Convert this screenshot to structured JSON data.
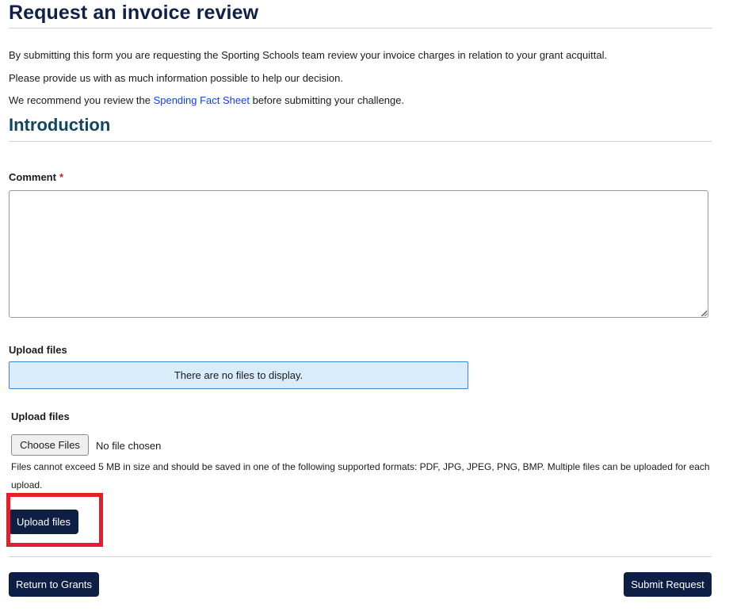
{
  "header": {
    "title": "Request an invoice review"
  },
  "intro": {
    "line1": "By submitting this form you are requesting the Sporting Schools team review your invoice charges in relation to your grant acquittal.",
    "line2": "Please provide us with as much information possible to help our decision.",
    "line3_prefix": "We recommend you review the ",
    "line3_link": "Spending Fact Sheet",
    "line3_suffix": " before submitting your challenge."
  },
  "section": {
    "title": "Introduction"
  },
  "comment": {
    "label": "Comment",
    "required_mark": "*",
    "value": ""
  },
  "attached_files": {
    "label": "Upload files",
    "empty_message": "There are no files to display."
  },
  "uploader": {
    "label": "Upload files",
    "choose_button": "Choose Files",
    "chosen_status": "No file chosen",
    "help_text": "Files cannot exceed 5 MB in size and should be saved in one of the following supported formats: PDF, JPG, JPEG, PNG, BMP. Multiple files can be uploaded for each upload.",
    "upload_button": "Upload files"
  },
  "footer": {
    "return_button": "Return to Grants",
    "submit_button": "Submit Request"
  },
  "colors": {
    "primary_dark": "#0e1f45",
    "title_navy": "#0f2146",
    "section_teal": "#12465c",
    "link_blue": "#1a3fd6",
    "info_banner_bg": "#d9ecfb",
    "info_banner_border": "#3e86d0",
    "required_red": "#c0232c",
    "highlight_red": "#e41e2b"
  }
}
